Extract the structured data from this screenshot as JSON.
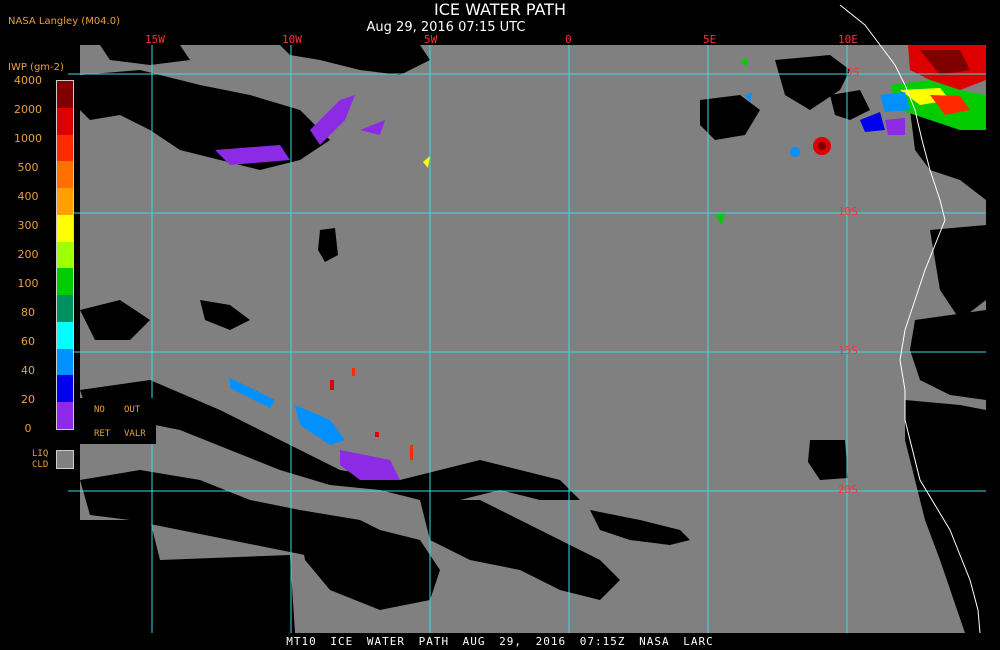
{
  "header": {
    "title": "ICE WATER PATH",
    "subtitle": "Aug 29, 2016 07:15 UTC",
    "org": "NASA Langley (M04.0)"
  },
  "map": {
    "lon_labels": [
      "15W",
      "10W",
      "5W",
      "0",
      "5E",
      "10E"
    ],
    "lat_labels": [
      "5S",
      "10S",
      "15S",
      "20S"
    ],
    "colors": {
      "sea": "#808080",
      "land": "#000000",
      "grid": "#40d8e0",
      "coast": "#ffffff",
      "label": "#ff3030"
    }
  },
  "legend": {
    "title": "IWP (gm-2)",
    "ticks": [
      "4000",
      "2000",
      "1000",
      "500",
      "400",
      "300",
      "200",
      "100",
      "80",
      "60",
      "40",
      "20",
      "0"
    ],
    "colors": [
      "#800000",
      "#dd0000",
      "#ff2a00",
      "#ff7000",
      "#ffa000",
      "#ffff00",
      "#a0ff00",
      "#00cc00",
      "#009060",
      "#00ffff",
      "#0090ff",
      "#0000ee",
      "#8c2ae6"
    ],
    "no_ret": [
      "NO",
      "RET"
    ],
    "out_valr": [
      "OUT",
      "VALR"
    ],
    "liq_cld": [
      "LIQ",
      "CLD"
    ]
  },
  "footer": "MT10 ICE WATER PATH AUG 29, 2016 07:15Z NASA LARC"
}
